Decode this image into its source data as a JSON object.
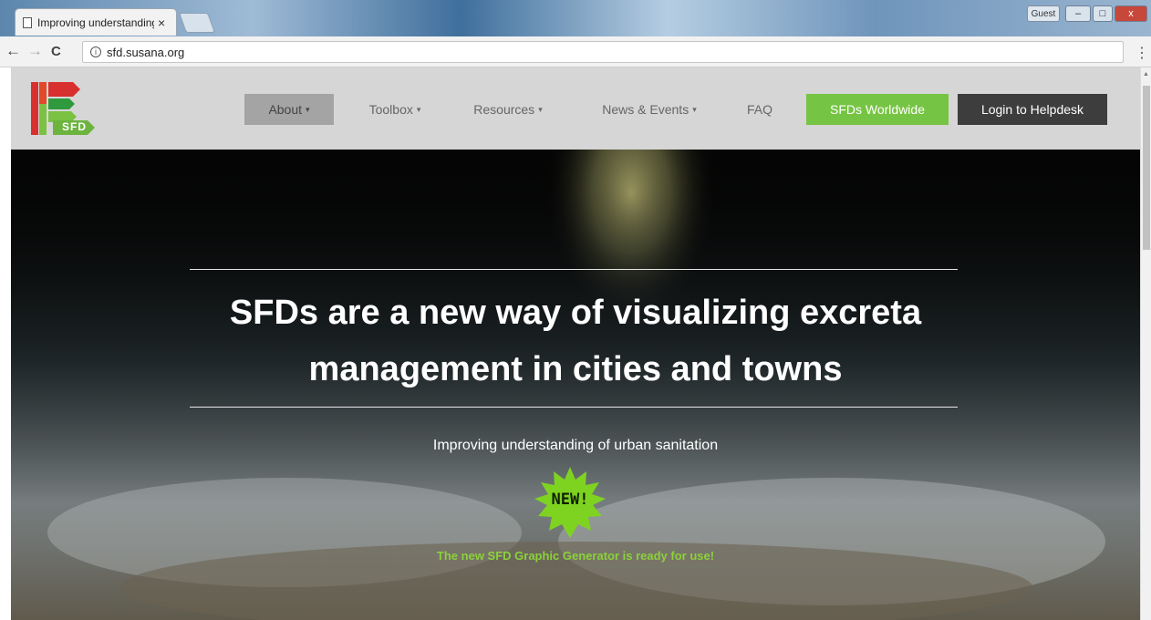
{
  "browser": {
    "tab_title": "Improving understanding",
    "tab_close": "×",
    "profile_label": "Guest",
    "url": "sfd.susana.org",
    "back_glyph": "←",
    "forward_glyph": "→",
    "reload_glyph": "C",
    "info_glyph": "i",
    "menu_glyph": "⋮",
    "minimize_glyph": "–",
    "maximize_glyph": "□",
    "close_glyph": "x"
  },
  "site": {
    "logo_text": "SFD",
    "nav": [
      {
        "label": "About",
        "has_dropdown": true
      },
      {
        "label": "Toolbox",
        "has_dropdown": true
      },
      {
        "label": "Resources",
        "has_dropdown": true
      },
      {
        "label": "News & Events",
        "has_dropdown": true
      },
      {
        "label": "FAQ",
        "has_dropdown": false
      }
    ],
    "cta_worldwide": "SFDs Worldwide",
    "cta_helpdesk": "Login to Helpdesk",
    "caret_glyph": "▾"
  },
  "hero": {
    "title_line1": "SFDs are a new way of visualizing excreta",
    "title_line2": "management in cities and towns",
    "subtitle": "Improving understanding of urban sanitation",
    "badge": "NEW!",
    "generator_message": "The new SFD Graphic Generator is ready for use!"
  },
  "colors": {
    "accent_green": "#76c443",
    "message_green": "#8bd13b",
    "header_gray": "#d6d6d6",
    "dark_button": "#3d3d3d"
  }
}
